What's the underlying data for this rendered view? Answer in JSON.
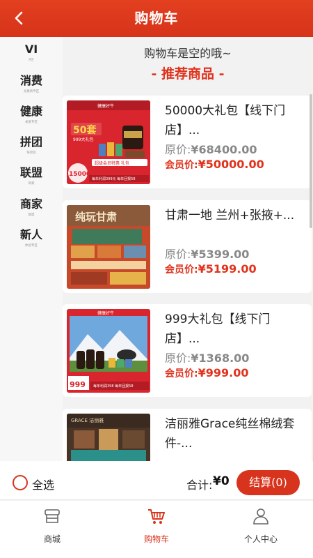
{
  "header": {
    "title": "购物车",
    "back_icon": "chevron-left-icon"
  },
  "sidebar": {
    "items": [
      {
        "label": "VI",
        "sub": "P区"
      },
      {
        "label": "消费",
        "sub": "兑换商专区"
      },
      {
        "label": "健康",
        "sub": "关爱专区"
      },
      {
        "label": "拼团",
        "sub": "免单区"
      },
      {
        "label": "联盟",
        "sub": "商家"
      },
      {
        "label": "商家",
        "sub": "联盟"
      },
      {
        "label": "新人",
        "sub": "体验专区"
      }
    ]
  },
  "main": {
    "empty_text": "购物车是空的哦~",
    "recommend_title": "- 推荐商品 -",
    "products": [
      {
        "name": "50000大礼包【线下门店】...",
        "orig_prefix": "原价:",
        "orig_price": "¥68400.00",
        "member_prefix": "会员价:",
        "member_price": "¥50000.00",
        "thumb": {
          "badge": "50套",
          "sub": "999大礼包",
          "brand": "健康好牛",
          "tag": "超级会员特惠 礼包",
          "price": "150000",
          "foot": "每年利润399元 每年回报58"
        }
      },
      {
        "name": "甘肃一地 兰州+张掖+...",
        "orig_prefix": "原价:",
        "orig_price": "¥5399.00",
        "member_prefix": "会员价:",
        "member_price": "¥5199.00",
        "thumb": {
          "badge": "纯玩甘肃",
          "sub": "",
          "brand": "",
          "tag": "",
          "price": "",
          "foot": ""
        }
      },
      {
        "name": "999大礼包【线下门店】...",
        "orig_prefix": "原价:",
        "orig_price": "¥1368.00",
        "member_prefix": "会员价:",
        "member_price": "¥999.00",
        "thumb": {
          "badge": "",
          "sub": "",
          "brand": "健康好牛",
          "tag": "",
          "price": "999",
          "foot": "每年利润398 每年回报58"
        }
      },
      {
        "name": "洁丽雅Grace纯丝棉绒套件-...",
        "orig_prefix": "",
        "orig_price": "",
        "member_prefix": "",
        "member_price": "",
        "thumb": {
          "badge": "",
          "sub": "",
          "brand": "GRACE 洁丽雅",
          "tag": "",
          "price": "",
          "foot": ""
        }
      }
    ]
  },
  "cart_bar": {
    "select_all": "全选",
    "total_label": "合计:",
    "total_value": "¥0",
    "checkout_label": "结算(0)"
  },
  "tabbar": {
    "items": [
      {
        "label": "商城",
        "icon": "store-icon",
        "active": false
      },
      {
        "label": "购物车",
        "icon": "cart-icon",
        "active": true
      },
      {
        "label": "个人中心",
        "icon": "person-icon",
        "active": false
      }
    ]
  },
  "colors": {
    "brand": "#d8331c",
    "header": "#e2401f",
    "price": "#e0321c"
  }
}
